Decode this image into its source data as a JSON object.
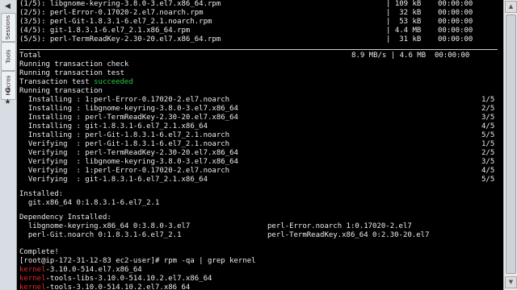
{
  "sidebar": {
    "tabs": [
      {
        "label": "Sessions"
      },
      {
        "label": "Tools"
      },
      {
        "label": "Macros"
      }
    ]
  },
  "download": {
    "rows": [
      {
        "name": "(1/5): libgnome-keyring-3.8.0-3.el7.x86_64.rpm",
        "size": "| 109 kB",
        "time": "00:00:00"
      },
      {
        "name": "(2/5): perl-Error-0.17020-2.el7.noarch.rpm",
        "size": "|  32 kB",
        "time": "00:00:00"
      },
      {
        "name": "(3/5): perl-Git-1.8.3.1-6.el7_2.1.noarch.rpm",
        "size": "|  53 kB",
        "time": "00:00:00"
      },
      {
        "name": "(4/5): git-1.8.3.1-6.el7_2.1.x86_64.rpm",
        "size": "| 4.4 MB",
        "time": "00:00:00"
      },
      {
        "name": "(5/5): perl-TermReadKey-2.30-20.el7.x86_64.rpm",
        "size": "|  31 kB",
        "time": "00:00:00"
      }
    ],
    "total_label": "Total",
    "total_stats": "8.9 MB/s | 4.6 MB  00:00:00"
  },
  "transaction": {
    "check": "Running transaction check",
    "test": "Running transaction test",
    "test_result_prefix": "Transaction test ",
    "test_result_status": "succeeded",
    "running": "Running transaction",
    "steps": [
      {
        "action": "  Installing : 1:perl-Error-0.17020-2.el7.noarch",
        "count": "1/5"
      },
      {
        "action": "  Installing : libgnome-keyring-3.8.0-3.el7.x86_64",
        "count": "2/5"
      },
      {
        "action": "  Installing : perl-TermReadKey-2.30-20.el7.x86_64",
        "count": "3/5"
      },
      {
        "action": "  Installing : git-1.8.3.1-6.el7_2.1.x86_64",
        "count": "4/5"
      },
      {
        "action": "  Installing : perl-Git-1.8.3.1-6.el7_2.1.noarch",
        "count": "5/5"
      },
      {
        "action": "  Verifying  : perl-Git-1.8.3.1-6.el7_2.1.noarch",
        "count": "1/5"
      },
      {
        "action": "  Verifying  : perl-TermReadKey-2.30-20.el7.x86_64",
        "count": "2/5"
      },
      {
        "action": "  Verifying  : libgnome-keyring-3.8.0-3.el7.x86_64",
        "count": "3/5"
      },
      {
        "action": "  Verifying  : 1:perl-Error-0.17020-2.el7.noarch",
        "count": "4/5"
      },
      {
        "action": "  Verifying  : git-1.8.3.1-6.el7_2.1.x86_64",
        "count": "5/5"
      }
    ]
  },
  "installed": {
    "header": "Installed:",
    "item": "  git.x86_64 0:1.8.3.1-6.el7_2.1"
  },
  "dependency": {
    "header": "Dependency Installed:",
    "left": [
      "  libgnome-keyring.x86_64 0:3.8.0-3.el7",
      "  perl-Git.noarch 0:1.8.3.1-6.el7_2.1"
    ],
    "right": [
      "perl-Error.noarch 1:0.17020-2.el7",
      "perl-TermReadKey.x86_64 0:2.30-20.el7"
    ]
  },
  "complete": "Complete!",
  "prompt": {
    "text": "[root@ip-172-31-12-83 ec2-user]# rpm -qa | grep kernel"
  },
  "kernel_results": [
    {
      "match": "kernel",
      "rest": "-3.10.0-514.el7.x86_64"
    },
    {
      "match": "kernel",
      "rest": "-tools-libs-3.10.0-514.10.2.el7.x86_64"
    },
    {
      "match": "kernel",
      "rest": "-tools-3.10.0-514.10.2.el7.x86_64"
    }
  ],
  "colors": {
    "terminal_bg": "#000000",
    "terminal_fg": "#ececec",
    "success": "#27c93f",
    "match": "#e0282e"
  }
}
